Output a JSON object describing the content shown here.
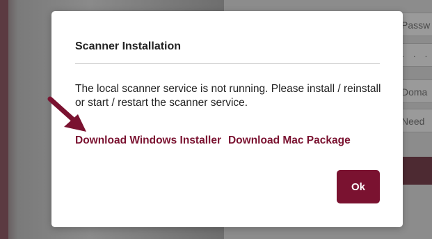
{
  "background": {
    "fields": [
      "Passw",
      "· · · · ·",
      "Doma",
      "Need"
    ]
  },
  "modal": {
    "title": "Scanner Installation",
    "message": "The local scanner service is not running. Please install / reinstall or start / restart the scanner service.",
    "links": {
      "windows": "Download Windows Installer",
      "mac": "Download Mac Package"
    },
    "ok_label": "Ok"
  },
  "colors": {
    "accent": "#7a1230",
    "arrow": "#7a1230"
  }
}
